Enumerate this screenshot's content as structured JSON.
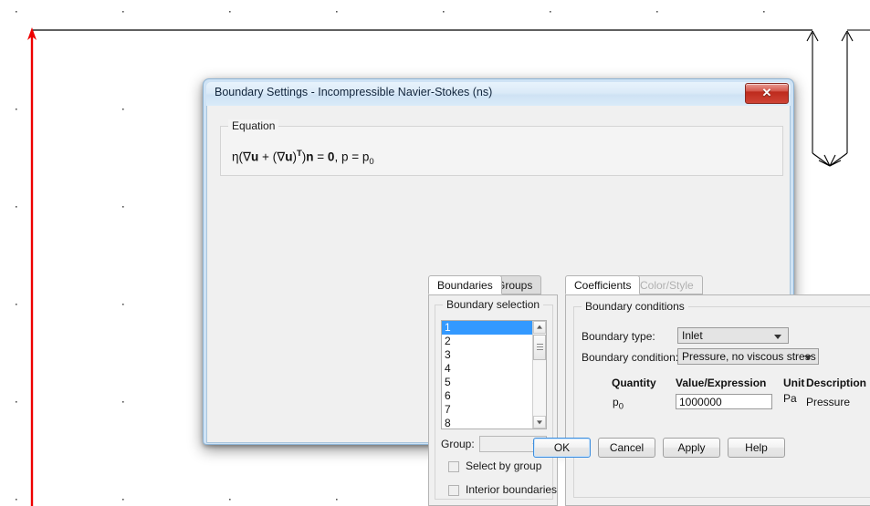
{
  "dialog": {
    "title": "Boundary Settings - Incompressible Navier-Stokes (ns)",
    "close_glyph": "✕",
    "equation": {
      "legend": "Equation",
      "text": "η(∇u + (∇u)T)n = 0, p = p0",
      "eta": "η",
      "nabla": "∇",
      "u": "u",
      "transpose": "T",
      "n": "n",
      "zero": "0",
      "p": "p",
      "p0_base": "p",
      "p0_sub": "0"
    },
    "left_tabs": [
      {
        "label": "Boundaries",
        "active": true,
        "disabled": false
      },
      {
        "label": "Groups",
        "active": false,
        "disabled": false
      }
    ],
    "right_tabs": [
      {
        "label": "Coefficients",
        "active": true,
        "disabled": false
      },
      {
        "label": "Color/Style",
        "active": false,
        "disabled": true
      }
    ],
    "boundary_selection": {
      "legend": "Boundary selection",
      "items": [
        "1",
        "2",
        "3",
        "4",
        "5",
        "6",
        "7",
        "8"
      ],
      "selected_index": 0,
      "group_label": "Group:",
      "group_value": "",
      "checkboxes": [
        {
          "label": "Select by group",
          "checked": false
        },
        {
          "label": "Interior boundaries",
          "checked": false
        }
      ]
    },
    "boundary_conditions": {
      "legend": "Boundary conditions",
      "boundary_type_label": "Boundary type:",
      "boundary_type_value": "Inlet",
      "boundary_condition_label": "Boundary condition:",
      "boundary_condition_value": "Pressure, no viscous stress",
      "columns": [
        "Quantity",
        "Value/Expression",
        "Unit",
        "Description"
      ],
      "row": {
        "quantity_base": "p",
        "quantity_sub": "0",
        "value": "1000000",
        "unit": "Pa",
        "description": "Pressure"
      }
    },
    "buttons": [
      {
        "label": "OK",
        "default": true
      },
      {
        "label": "Cancel",
        "default": false
      },
      {
        "label": "Apply",
        "default": false
      },
      {
        "label": "Help",
        "default": false
      }
    ]
  },
  "colors": {
    "title_text": "#10243b",
    "selection_blue": "#3399ff",
    "close_red": "#bd2a1c",
    "geometry_red": "#ee0000",
    "geometry_black": "#000000"
  },
  "canvas": {
    "grid_dot_color": "#555555",
    "red_axis_arrow": "vertical-up-arrow-left",
    "top_edge_line": "horizontal-black-line",
    "dimension_arrows": [
      "right-dimension-down",
      "right-dimension-up",
      "bottom-dimension-up"
    ]
  }
}
